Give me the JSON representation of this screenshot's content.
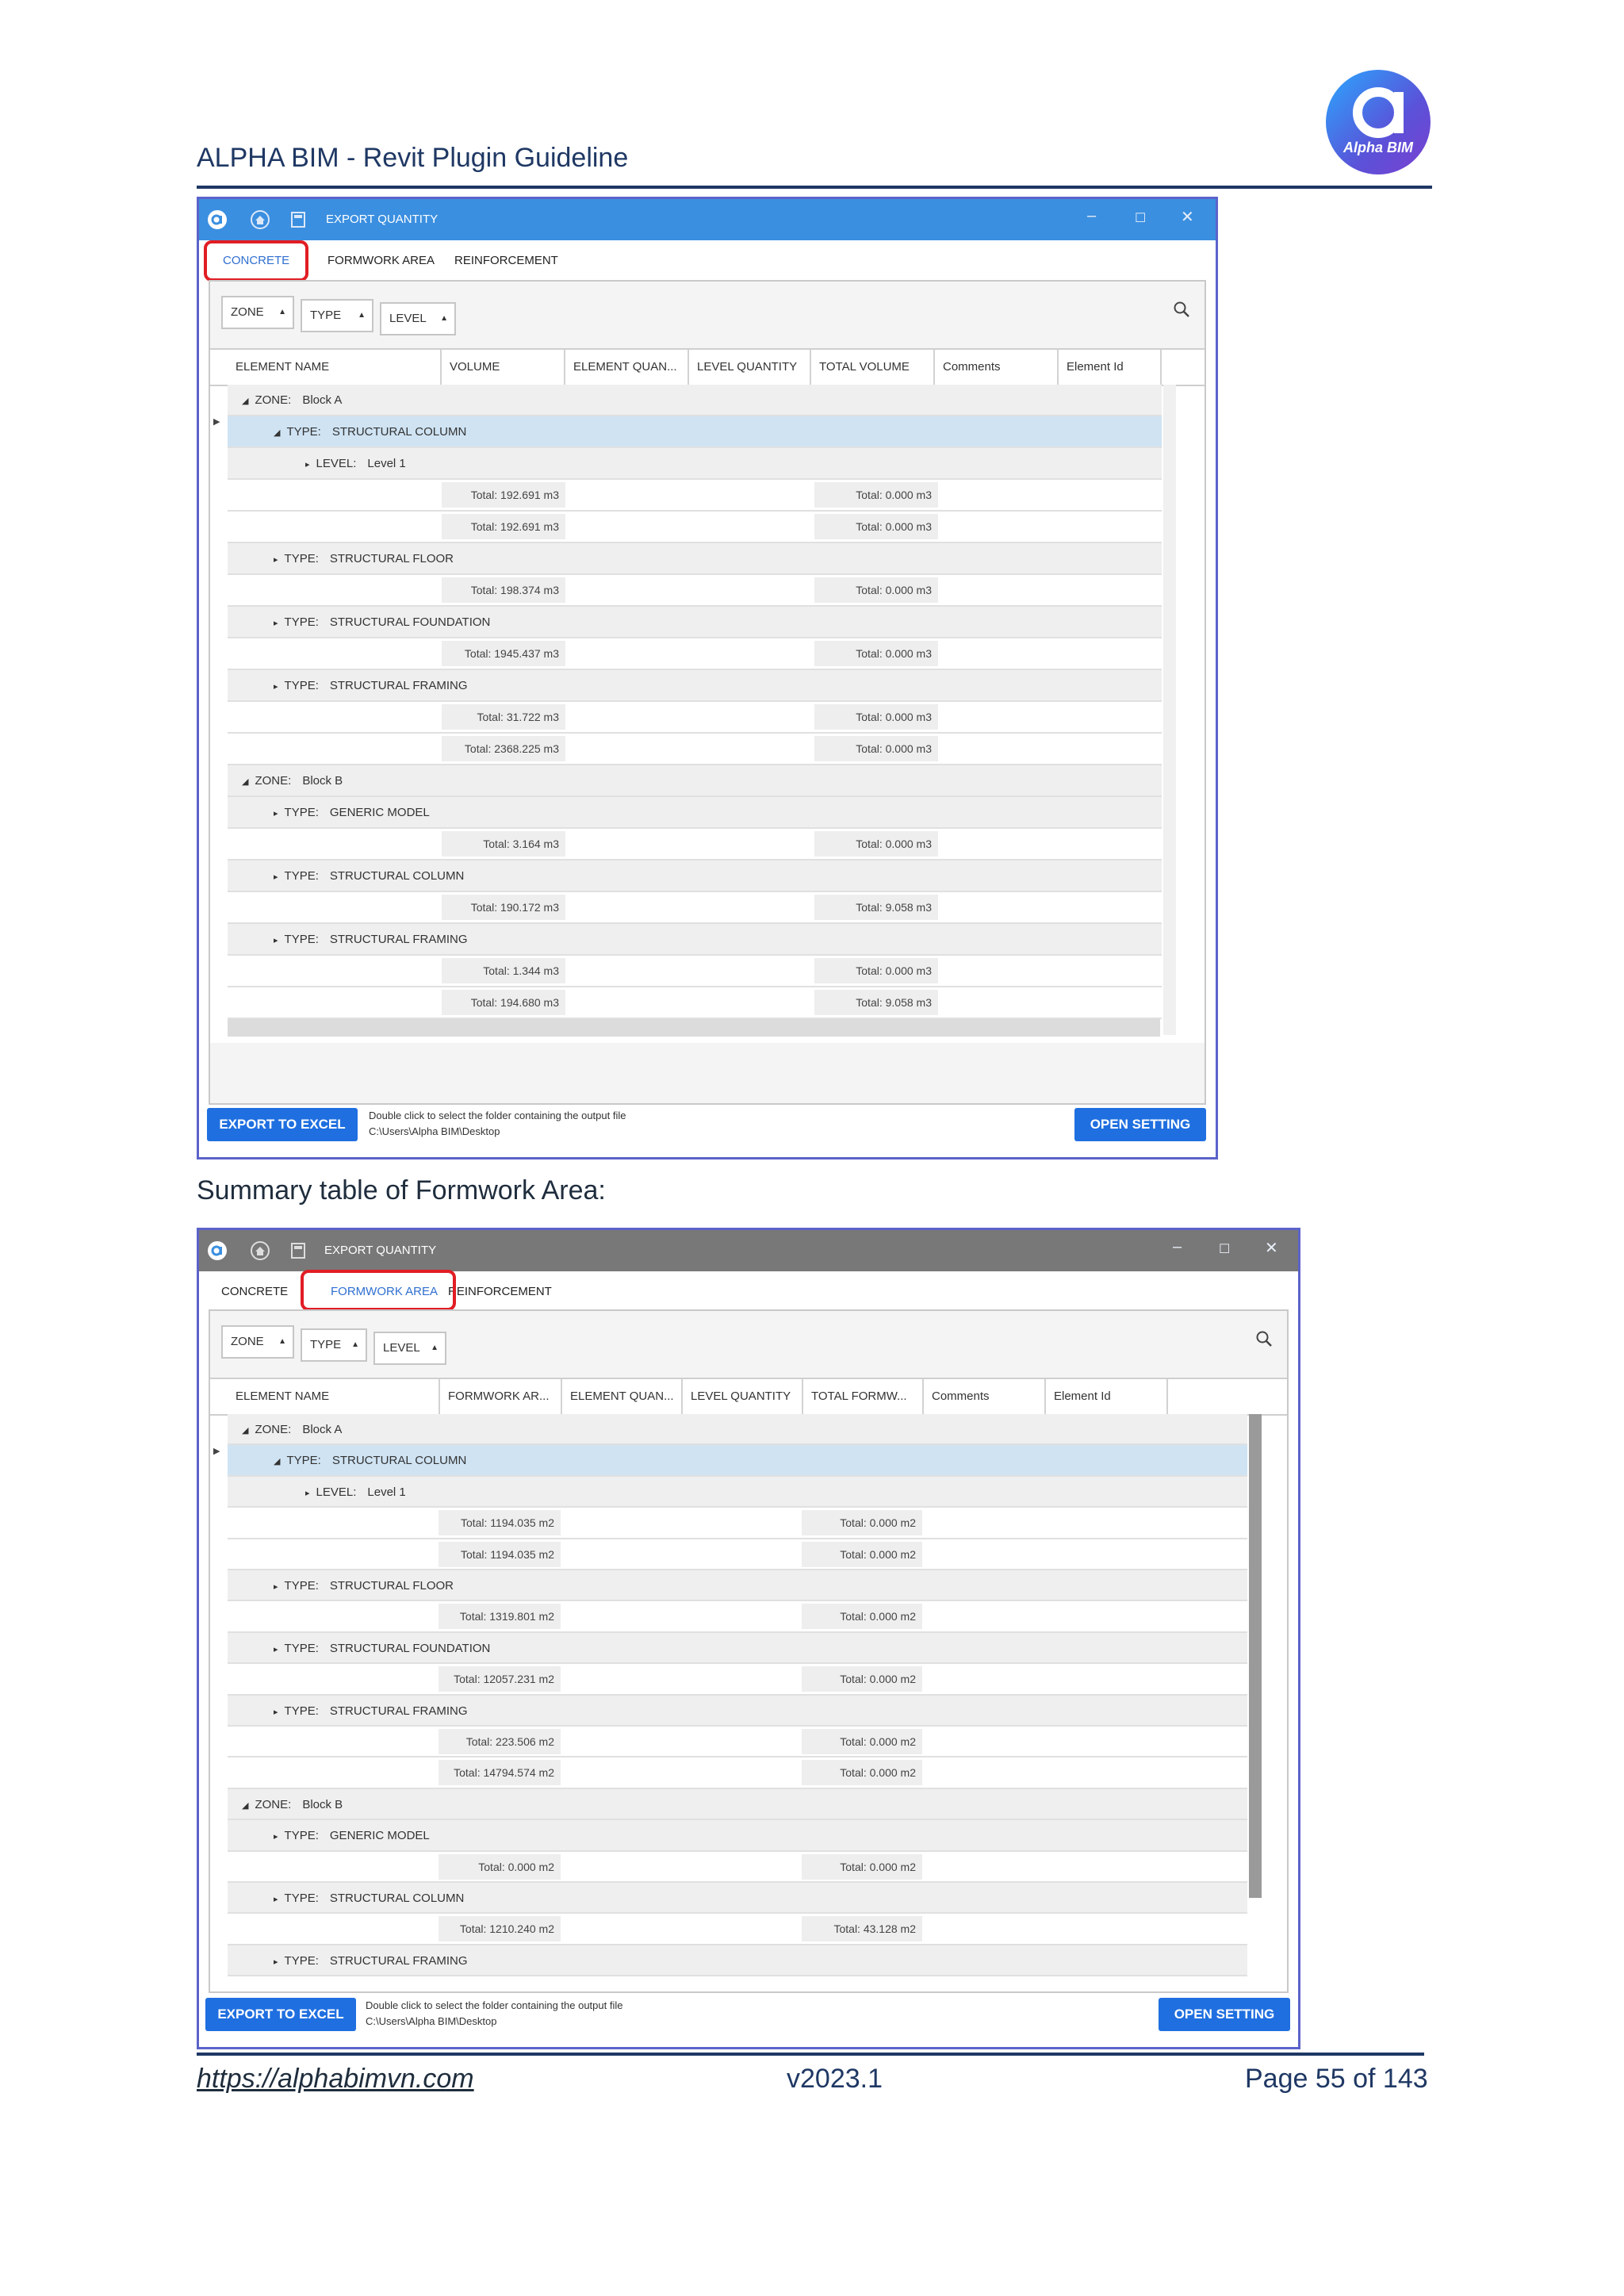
{
  "document": {
    "header_title": "ALPHA BIM - Revit Plugin Guideline",
    "logo_text": "Alpha BIM",
    "caption": "Summary table of Formwork Area:",
    "footer": {
      "link": "https://alphabimvn.com",
      "version": "v2023.1",
      "page": "Page 55 of 143"
    },
    "colors": {
      "brand_navy": "#1f3864",
      "accent_blue": "#1f6fe0",
      "highlight_red": "#e11d24",
      "frame_purple": "#5b63c9"
    }
  },
  "windows": [
    {
      "title": "EXPORT QUANTITY",
      "tabs": [
        "CONCRETE",
        "FORMWORK AREA",
        "REINFORCEMENT"
      ],
      "active_tab": "CONCRETE",
      "filters": [
        "ZONE",
        "TYPE",
        "LEVEL"
      ],
      "columns": [
        "ELEMENT NAME",
        "VOLUME",
        "ELEMENT QUAN...",
        "LEVEL QUANTITY",
        "TOTAL VOLUME",
        "Comments",
        "Element Id"
      ],
      "rows": [
        {
          "kind": "zone",
          "label": "ZONE:",
          "value": "Block A"
        },
        {
          "kind": "type",
          "label": "TYPE:",
          "value": "STRUCTURAL COLUMN",
          "selected": true
        },
        {
          "kind": "level",
          "label": "LEVEL:",
          "value": "Level 1"
        },
        {
          "kind": "total",
          "a": "Total: 192.691 m3",
          "b": "Total: 0.000 m3"
        },
        {
          "kind": "total",
          "a": "Total: 192.691 m3",
          "b": "Total: 0.000 m3"
        },
        {
          "kind": "type",
          "label": "TYPE:",
          "value": "STRUCTURAL FLOOR"
        },
        {
          "kind": "total",
          "a": "Total: 198.374 m3",
          "b": "Total: 0.000 m3"
        },
        {
          "kind": "type",
          "label": "TYPE:",
          "value": "STRUCTURAL FOUNDATION"
        },
        {
          "kind": "total",
          "a": "Total: 1945.437 m3",
          "b": "Total: 0.000 m3"
        },
        {
          "kind": "type",
          "label": "TYPE:",
          "value": "STRUCTURAL FRAMING"
        },
        {
          "kind": "total",
          "a": "Total: 31.722 m3",
          "b": "Total: 0.000 m3"
        },
        {
          "kind": "total",
          "a": "Total: 2368.225 m3",
          "b": "Total: 0.000 m3"
        },
        {
          "kind": "zone",
          "label": "ZONE:",
          "value": "Block B"
        },
        {
          "kind": "type",
          "label": "TYPE:",
          "value": "GENERIC MODEL"
        },
        {
          "kind": "total",
          "a": "Total: 3.164 m3",
          "b": "Total: 0.000 m3"
        },
        {
          "kind": "type",
          "label": "TYPE:",
          "value": "STRUCTURAL COLUMN"
        },
        {
          "kind": "total",
          "a": "Total: 190.172 m3",
          "b": "Total: 9.058 m3"
        },
        {
          "kind": "type",
          "label": "TYPE:",
          "value": "STRUCTURAL FRAMING"
        },
        {
          "kind": "total",
          "a": "Total: 1.344 m3",
          "b": "Total: 0.000 m3"
        },
        {
          "kind": "total",
          "a": "Total: 194.680 m3",
          "b": "Total: 9.058 m3"
        }
      ],
      "export_button": "EXPORT TO EXCEL",
      "hint_line1": "Double click to select the folder containing the output file",
      "hint_line2": "C:\\Users\\Alpha BIM\\Desktop",
      "setting_button": "OPEN SETTING"
    },
    {
      "title": "EXPORT QUANTITY",
      "tabs": [
        "CONCRETE",
        "FORMWORK AREA",
        "REINFORCEMENT"
      ],
      "active_tab": "FORMWORK AREA",
      "filters": [
        "ZONE",
        "TYPE",
        "LEVEL"
      ],
      "columns": [
        "ELEMENT NAME",
        "FORMWORK AR...",
        "ELEMENT QUAN...",
        "LEVEL QUANTITY",
        "TOTAL FORMW...",
        "Comments",
        "Element Id"
      ],
      "rows": [
        {
          "kind": "zone",
          "label": "ZONE:",
          "value": "Block A"
        },
        {
          "kind": "type",
          "label": "TYPE:",
          "value": "STRUCTURAL COLUMN",
          "selected": true
        },
        {
          "kind": "level",
          "label": "LEVEL:",
          "value": "Level 1"
        },
        {
          "kind": "total",
          "a": "Total: 1194.035 m2",
          "b": "Total: 0.000 m2"
        },
        {
          "kind": "total",
          "a": "Total: 1194.035 m2",
          "b": "Total: 0.000 m2"
        },
        {
          "kind": "type",
          "label": "TYPE:",
          "value": "STRUCTURAL FLOOR"
        },
        {
          "kind": "total",
          "a": "Total: 1319.801 m2",
          "b": "Total: 0.000 m2"
        },
        {
          "kind": "type",
          "label": "TYPE:",
          "value": "STRUCTURAL FOUNDATION"
        },
        {
          "kind": "total",
          "a": "Total: 12057.231 m2",
          "b": "Total: 0.000 m2"
        },
        {
          "kind": "type",
          "label": "TYPE:",
          "value": "STRUCTURAL FRAMING"
        },
        {
          "kind": "total",
          "a": "Total: 223.506 m2",
          "b": "Total: 0.000 m2"
        },
        {
          "kind": "total",
          "a": "Total: 14794.574 m2",
          "b": "Total: 0.000 m2"
        },
        {
          "kind": "zone",
          "label": "ZONE:",
          "value": "Block B"
        },
        {
          "kind": "type",
          "label": "TYPE:",
          "value": "GENERIC MODEL"
        },
        {
          "kind": "total",
          "a": "Total: 0.000 m2",
          "b": "Total: 0.000 m2"
        },
        {
          "kind": "type",
          "label": "TYPE:",
          "value": "STRUCTURAL COLUMN"
        },
        {
          "kind": "total",
          "a": "Total: 1210.240 m2",
          "b": "Total: 43.128 m2"
        },
        {
          "kind": "type",
          "label": "TYPE:",
          "value": "STRUCTURAL FRAMING"
        }
      ],
      "export_button": "EXPORT TO EXCEL",
      "hint_line1": "Double click to select the folder containing the output file",
      "hint_line2": "C:\\Users\\Alpha BIM\\Desktop",
      "setting_button": "OPEN SETTING"
    }
  ]
}
